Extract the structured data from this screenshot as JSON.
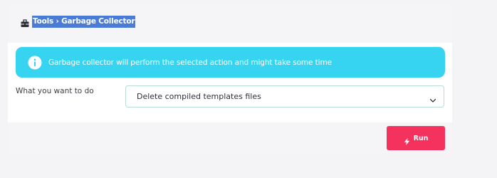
{
  "breadcrumb": {
    "icon": "toolbox-icon",
    "text": "Tools › Garbage Collector"
  },
  "alert": {
    "icon": "info-icon",
    "message": "Garbage collector will perform the selected action and might take some time",
    "color": "#37d4f2"
  },
  "form": {
    "action_label": "What you want to do",
    "action_select": {
      "selected": "Delete compiled templates files",
      "icon": "chevron-down-icon"
    }
  },
  "footer": {
    "run_button": {
      "label": "Run",
      "icon": "bolt-icon",
      "color": "#f5315e"
    }
  }
}
